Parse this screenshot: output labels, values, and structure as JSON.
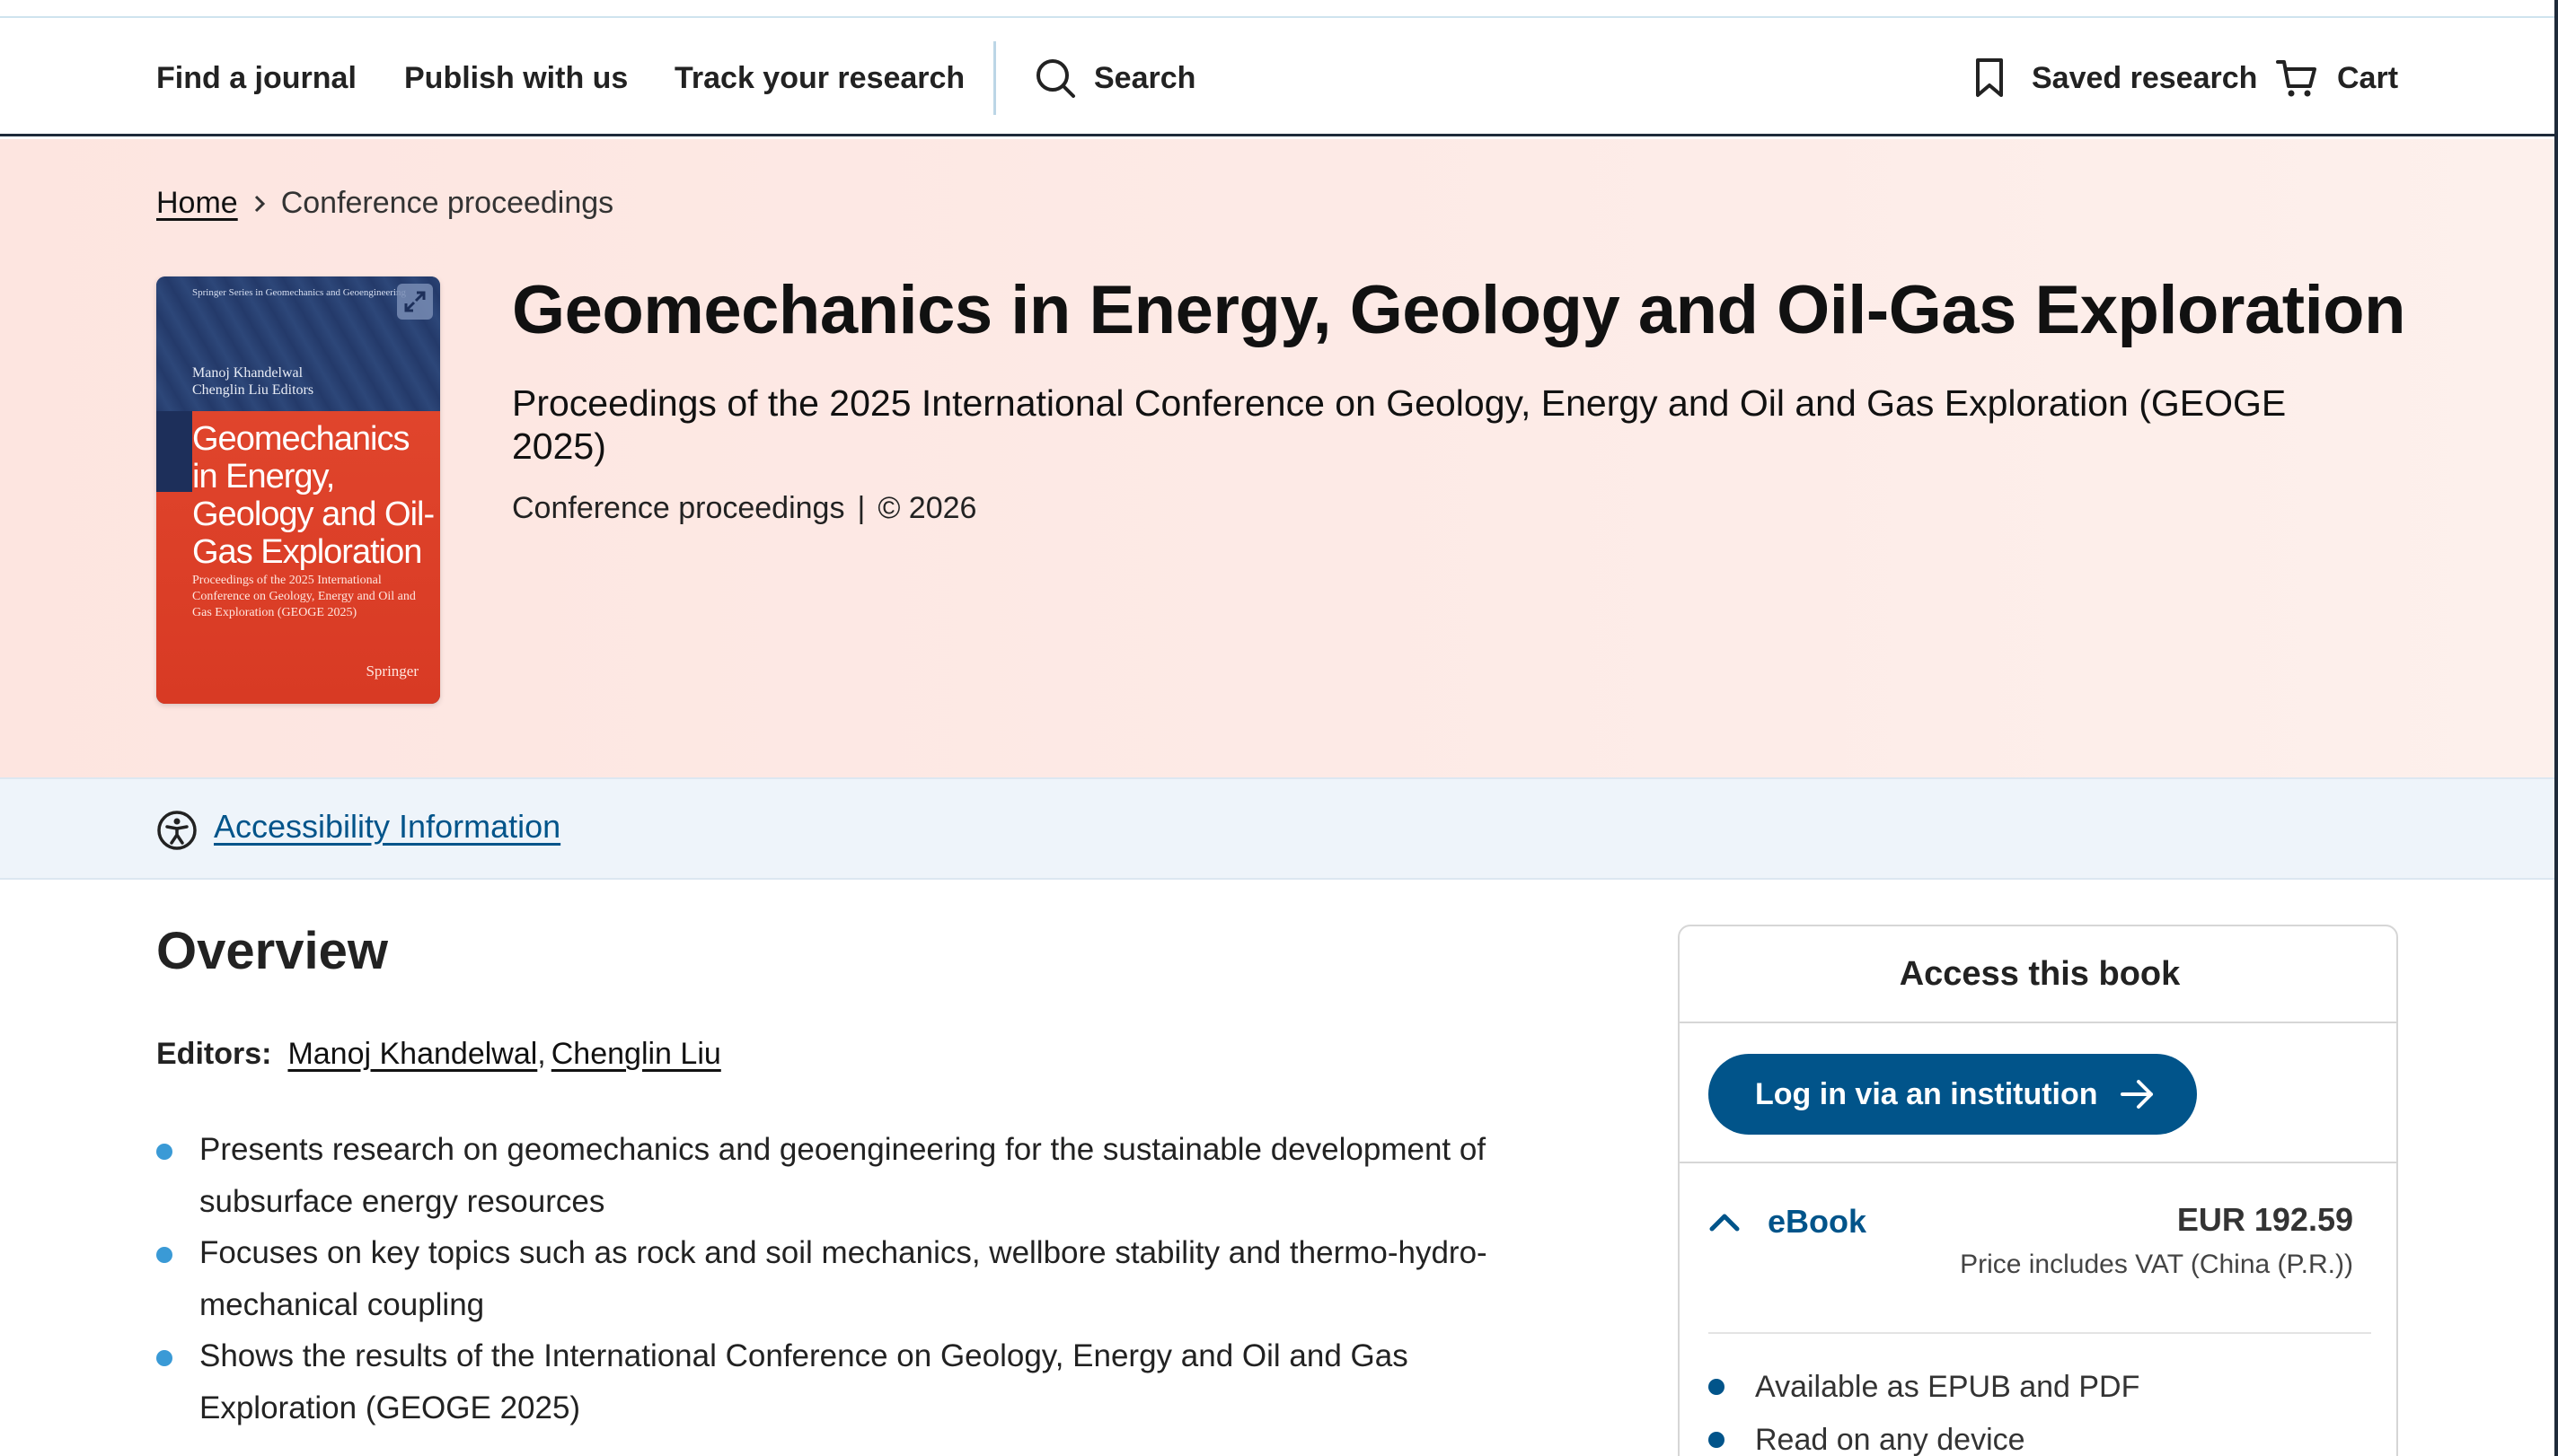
{
  "nav": {
    "find_journal": "Find a journal",
    "publish": "Publish with us",
    "track": "Track your research",
    "search": "Search",
    "saved": "Saved research",
    "cart": "Cart"
  },
  "breadcrumb": {
    "home": "Home",
    "current": "Conference proceedings"
  },
  "cover": {
    "series": "Springer Series in Geomechanics and Geoengineering",
    "editors": [
      "Manoj Khandelwal",
      "Chenglin Liu  Editors"
    ],
    "title": "Geomechanics in Energy, Geology and Oil-Gas Exploration",
    "subtitle": "Proceedings of the 2025 International Conference on Geology, Energy and Oil and Gas Exploration (GEOGE 2025)",
    "publisher": "Springer"
  },
  "book": {
    "title": "Geomechanics in Energy, Geology and Oil-Gas Exploration",
    "subtitle": "Proceedings of the 2025 International Conference on Geology, Energy and Oil and Gas Exploration (GEOGE 2025)",
    "type": "Conference proceedings",
    "separator": "|",
    "copyright": "© 2026"
  },
  "accessibility": {
    "link": "Accessibility Information"
  },
  "overview": {
    "heading": "Overview",
    "editors_label": "Editors:",
    "editors": [
      "Manoj Khandelwal",
      "Chenglin Liu"
    ],
    "editors_sep": ",",
    "bullets": [
      "Presents research on geomechanics and geoengineering for the sustainable development of subsurface energy resources",
      "Focuses on key topics such as rock and soil mechanics, wellbore stability and thermo-hydro-mechanical coupling",
      "Shows the results of the International Conference on Geology, Energy and Oil and Gas Exploration (GEOGE 2025)"
    ]
  },
  "access": {
    "heading": "Access this book",
    "login": "Log in via an institution",
    "ebook_label": "eBook",
    "price": "EUR 192.59",
    "vat": "Price includes VAT (China (P.R.))",
    "features": [
      "Available as EPUB and PDF",
      "Read on any device"
    ]
  },
  "colors": {
    "brand_blue": "#01548a",
    "hero_bg": "#fde5e0",
    "a11y_bg": "#eef4fa",
    "bullet_blue": "#3a9ad6"
  },
  "icons": [
    "search-icon",
    "bookmark-icon",
    "cart-icon",
    "chevron-right-icon",
    "expand-icon",
    "accessibility-icon",
    "arrow-right-icon",
    "chevron-up-icon"
  ]
}
